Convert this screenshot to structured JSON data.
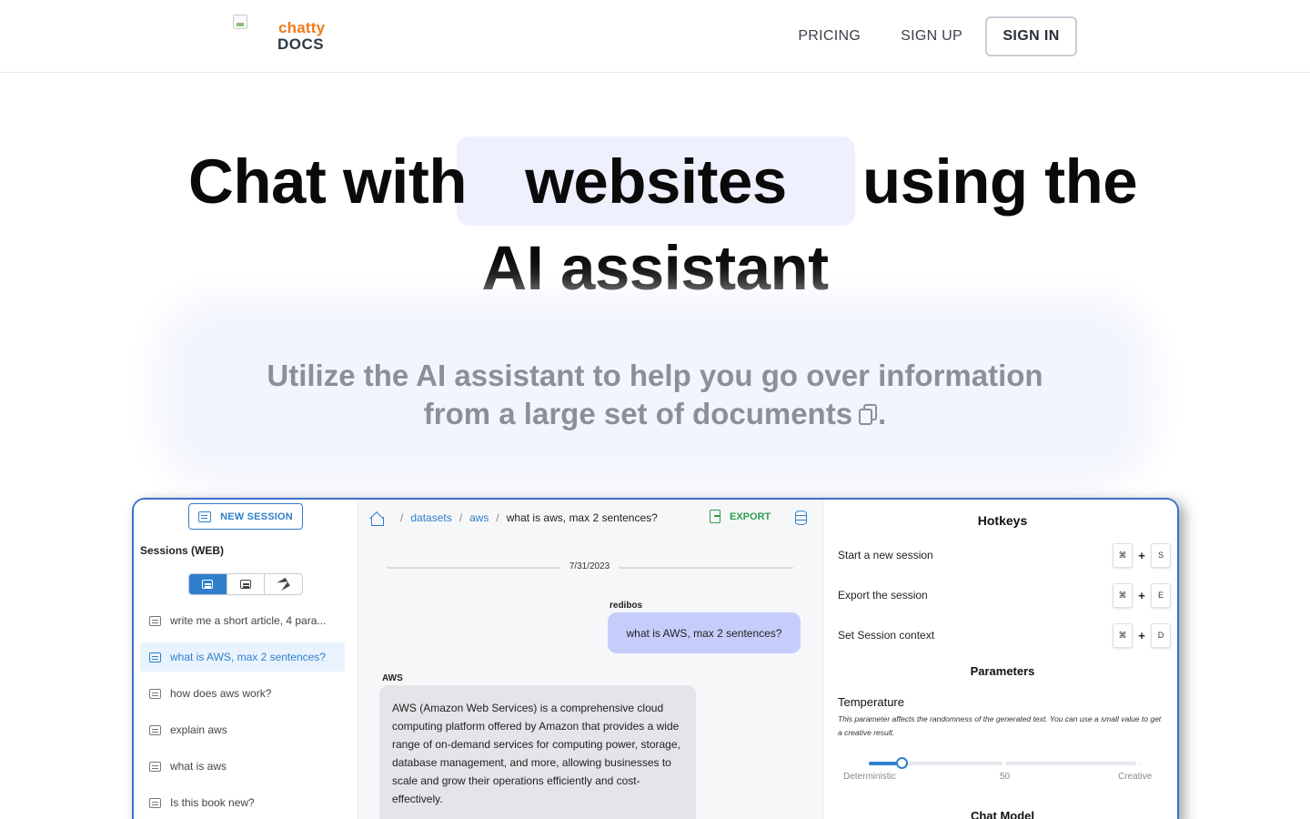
{
  "logo": {
    "line1": "chatty",
    "line2": "DOCS"
  },
  "nav": {
    "pricing": "PRICING",
    "signup": "SIGN UP",
    "signin": "SIGN IN"
  },
  "hero": {
    "word1": "Chat with",
    "highlight": "websites",
    "word2": "using the",
    "line2": "AI assistant",
    "subtitle_line1": "Utilize the AI assistant to help you go over information",
    "subtitle_line2": "from a large set of documents",
    "subtitle_end": "."
  },
  "app": {
    "sidebar": {
      "new_session": "NEW SESSION",
      "sessions_title": "Sessions (WEB)",
      "sessions": [
        "write me a short article, 4 para...",
        "what is AWS, max 2 sentences?",
        "how does aws work?",
        "explain aws",
        "what is aws",
        "Is this book new?"
      ],
      "active_index": 1
    },
    "chat": {
      "breadcrumb": [
        "datasets",
        "aws",
        "what is aws, max 2 sentences?"
      ],
      "export": "EXPORT",
      "date": "7/31/2023",
      "user_name": "redibos",
      "user_message": "what is AWS, max 2 sentences?",
      "bot_name": "AWS",
      "bot_message": "AWS (Amazon Web Services) is a comprehensive cloud computing platform offered by Amazon that provides a wide range of on-demand services for computing power, storage, database management, and more, allowing businesses to scale and grow their operations efficiently and cost-effectively."
    },
    "panel": {
      "hotkeys_title": "Hotkeys",
      "hotkeys": [
        {
          "label": "Start a new session",
          "mod": "⌘",
          "plus": "+",
          "key": "S"
        },
        {
          "label": "Export the session",
          "mod": "⌘",
          "plus": "+",
          "key": "E"
        },
        {
          "label": "Set Session context",
          "mod": "⌘",
          "plus": "+",
          "key": "D"
        }
      ],
      "parameters_title": "Parameters",
      "temperature_label": "Temperature",
      "temperature_desc": "This parameter affects the randomness of the generated text. You can use a small value to get a creative result.",
      "slider_value": 0.12,
      "slider_min_label": "Deterministic",
      "slider_mid_label": "50",
      "slider_max_label": "Creative",
      "chat_model_title": "Chat Model"
    }
  },
  "colors": {
    "accent": "#2f7fcb",
    "logo_orange": "#f07a16",
    "export_green": "#2e9d4a",
    "user_bubble": "#c6cdfa"
  }
}
